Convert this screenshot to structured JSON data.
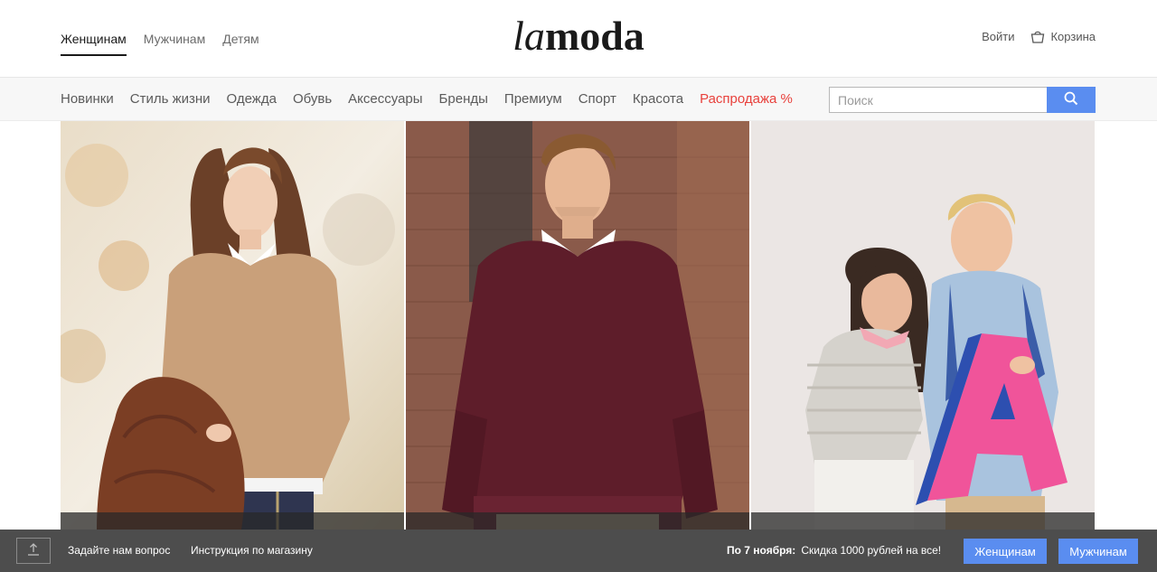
{
  "header": {
    "gender_tabs": [
      {
        "label": "Женщинам",
        "active": true
      },
      {
        "label": "Мужчинам",
        "active": false
      },
      {
        "label": "Детям",
        "active": false
      }
    ],
    "logo": {
      "part1": "la",
      "part2": "moda"
    },
    "login_label": "Войти",
    "cart_label": "Корзина",
    "cart_icon": "shopping-bag-icon"
  },
  "categories": [
    {
      "label": "Новинки"
    },
    {
      "label": "Стиль жизни"
    },
    {
      "label": "Одежда"
    },
    {
      "label": "Обувь"
    },
    {
      "label": "Аксессуары"
    },
    {
      "label": "Бренды"
    },
    {
      "label": "Премиум"
    },
    {
      "label": "Спорт"
    },
    {
      "label": "Красота"
    },
    {
      "label": "Распродажа %",
      "highlight": "#e8413c"
    }
  ],
  "search": {
    "placeholder": "Поиск",
    "value": "",
    "button_icon": "search-icon"
  },
  "tiles": [
    {
      "name": "women",
      "description_icon": "photo-woman"
    },
    {
      "name": "men",
      "description_icon": "photo-man"
    },
    {
      "name": "kids",
      "description_icon": "photo-kids"
    }
  ],
  "bottom_bar": {
    "upload_icon": "upload-icon",
    "ask_link": "Задайте нам вопрос",
    "guide_link": "Инструкция по магазину",
    "promo_date": "По 7 ноября:",
    "promo_text": "Скидка 1000 рублей на все!",
    "women_button": "Женщинам",
    "men_button": "Мужчинам"
  },
  "colors": {
    "accent": "#5a8df0",
    "sale": "#e8413c",
    "bottom_bar": "#4d4d4d"
  }
}
